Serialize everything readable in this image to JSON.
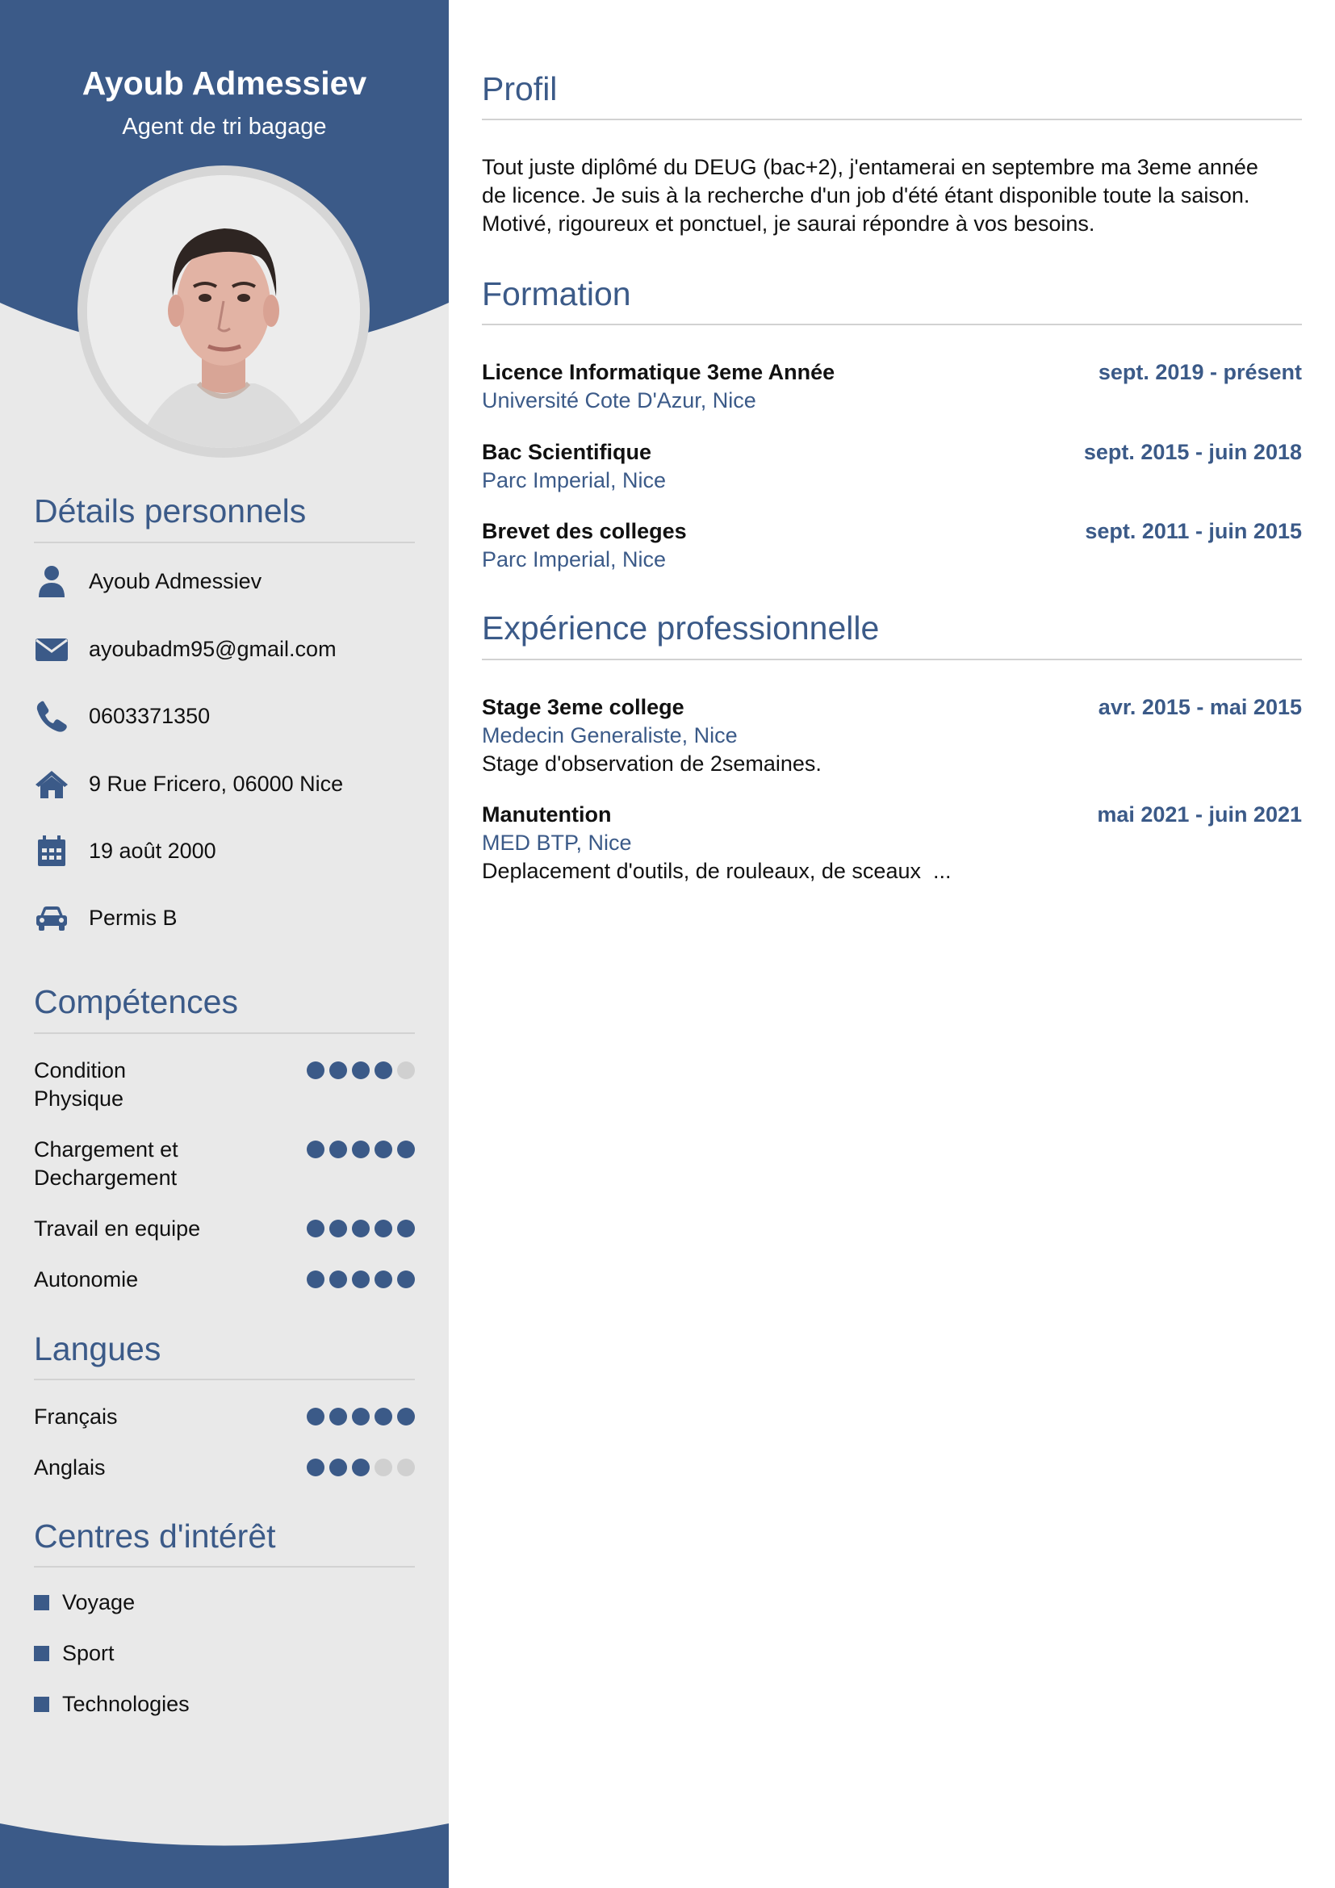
{
  "header": {
    "name": "Ayoub Admessiev",
    "job_title": "Agent de tri bagage"
  },
  "sections": {
    "details": "Détails personnels",
    "skills": "Compétences",
    "languages": "Langues",
    "interests": "Centres d'intérêt",
    "profile": "Profil",
    "education": "Formation",
    "experience": "Expérience professionnelle"
  },
  "details": [
    {
      "icon": "person-icon",
      "text": "Ayoub Admessiev"
    },
    {
      "icon": "envelope-icon",
      "text": "ayoubadm95@gmail.com"
    },
    {
      "icon": "phone-icon",
      "text": "0603371350"
    },
    {
      "icon": "home-icon",
      "text": "9 Rue Fricero, 06000 Nice"
    },
    {
      "icon": "calendar-icon",
      "text": "19 août 2000"
    },
    {
      "icon": "car-icon",
      "text": "Permis B"
    }
  ],
  "skills": [
    {
      "line1": "Condition",
      "line2": "Physique",
      "level": 4,
      "max": 5
    },
    {
      "line1": "Chargement et",
      "line2": "Dechargement",
      "level": 5,
      "max": 5
    },
    {
      "line1": "Travail en equipe",
      "line2": "",
      "level": 5,
      "max": 5
    },
    {
      "line1": "Autonomie",
      "line2": "",
      "level": 5,
      "max": 5
    }
  ],
  "languages": [
    {
      "label": "Français",
      "level": 5,
      "max": 5
    },
    {
      "label": "Anglais",
      "level": 3,
      "max": 5
    }
  ],
  "interests": [
    "Voyage",
    "Sport",
    "Technologies"
  ],
  "profile": {
    "line1": "Tout juste diplômé du DEUG (bac+2), j'entamerai en septembre ma 3eme année",
    "line2": "de licence. Je suis à la recherche d'un job d'été étant disponible toute la saison.",
    "line3": "Motivé, rigoureux et ponctuel, je saurai répondre à vos besoins."
  },
  "education": [
    {
      "title": "Licence Informatique 3eme Année",
      "date": "sept. 2019 - présent",
      "place": "Université Cote D'Azur, Nice"
    },
    {
      "title": "Bac Scientifique",
      "date": "sept. 2015 - juin 2018",
      "place": "Parc Imperial, Nice"
    },
    {
      "title": "Brevet des colleges",
      "date": "sept. 2011 - juin 2015",
      "place": "Parc Imperial, Nice"
    }
  ],
  "experience": [
    {
      "title": "Stage 3eme college",
      "date": "avr. 2015 - mai 2015",
      "place": "Medecin Generaliste, Nice",
      "desc": "Stage d'observation de 2semaines."
    },
    {
      "title": "Manutention",
      "date": "mai 2021 - juin 2021",
      "place": "MED BTP, Nice",
      "desc": "Deplacement d'outils, de rouleaux, de sceaux  ..."
    }
  ],
  "colors": {
    "accent": "#3b5a88",
    "sidebar_bg": "#e9e9e9",
    "dot_off": "#d0d0d0"
  }
}
